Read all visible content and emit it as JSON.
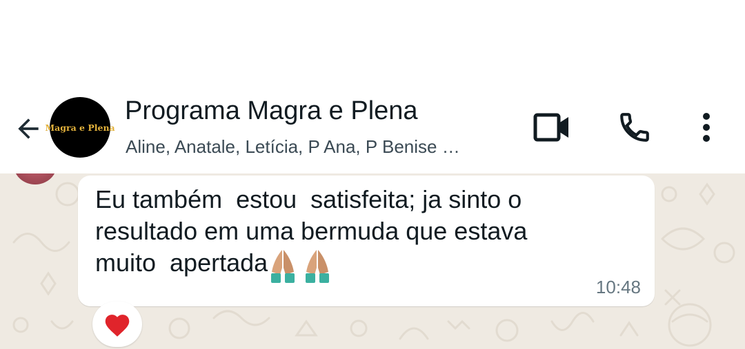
{
  "header": {
    "avatar_text": "Magra e Plena",
    "title": "Programa Magra e Plena",
    "members": "Aline, Anatale, Letícia, P Ana, P Benise …",
    "icons": [
      "back-arrow-icon",
      "video-call-icon",
      "phone-call-icon",
      "more-options-icon"
    ]
  },
  "message": {
    "text": "Eu também  estou  satisfeita; ja sinto o\nresultado em uma bermuda que estava\nmuito  apertada",
    "emoji": [
      "folded-hands-emoji",
      "folded-hands-emoji"
    ],
    "time": "10:48",
    "reaction": "red-heart-emoji"
  },
  "colors": {
    "chat_background": "#efeae2",
    "bubble": "#ffffff",
    "primary_text": "#111b21",
    "secondary_text": "#667781",
    "reaction_heart": "#e0242b"
  }
}
